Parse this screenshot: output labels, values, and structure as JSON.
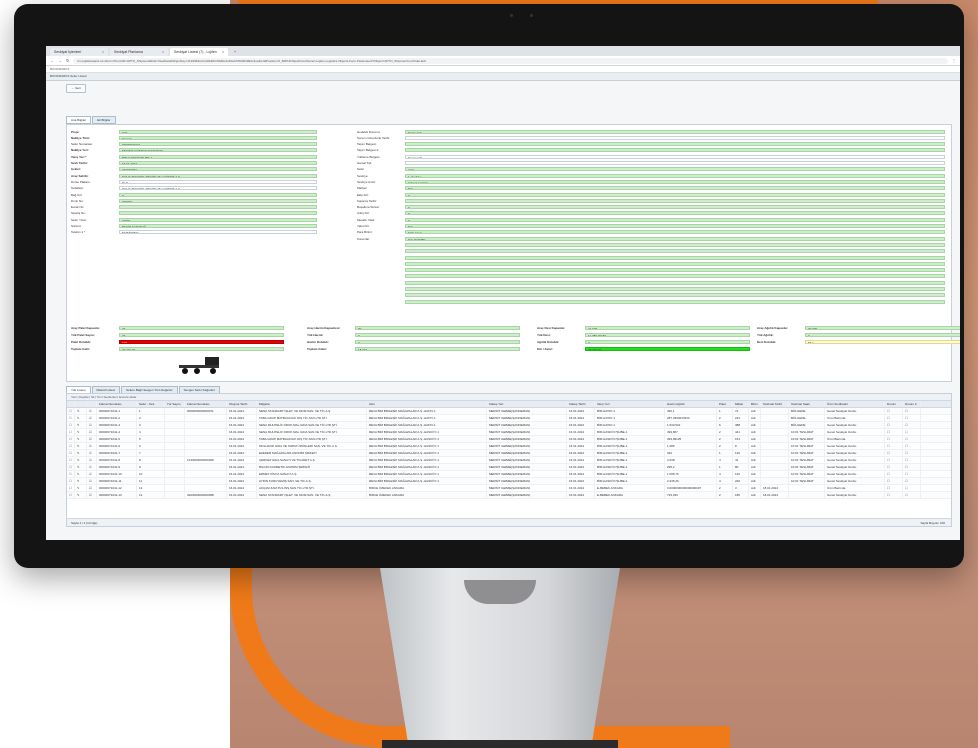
{
  "browser": {
    "tabs": [
      {
        "label": "Sevkiyat İşlemleri"
      },
      {
        "label": "Sevkiyat Planlama"
      },
      {
        "label": "Sevkiyat Listesi (7) - Lojiten"
      }
    ],
    "url": "bm.lojistiksiparis.com/Form?FormID=APTO_Shipment&Dat=ViewDetailObjectKey=113935&Col=dif1&ID=8&Mod=&Sid=P0000409Active&GridPosition=0_8087&ObjectFormName=Lojiten.Logistics.Objects.Form.Parameters?Object=APTO_ShipmentIn.txOrder.Exit",
    "bookmarks": "BOOKMARKS",
    "appbar": "BOOKMARKS  Sefer Listesi"
  },
  "toolbar": {
    "button": "← Geri"
  },
  "form_tabs": [
    {
      "label": "Ana Bilgiler"
    },
    {
      "label": "Ek Bilgiler"
    }
  ],
  "left_fields": [
    {
      "label": "Proje:",
      "value": "IHO",
      "bold": true,
      "style": "green"
    },
    {
      "label": "Nakliye Türü:",
      "value": "Komple",
      "bold": true,
      "style": "green"
    },
    {
      "label": "Sefer Numarası:",
      "value": "00000071041",
      "bold": false,
      "style": "green"
    },
    {
      "label": "Nakliye Yeri:",
      "value": "MERSİT GEBZE(ŞANDEMAN)",
      "bold": true,
      "style": "green"
    },
    {
      "label": "Varış Yeri *",
      "value": "BİM HASKÖY/ŞUBE-1",
      "bold": true,
      "style": "green"
    },
    {
      "label": "Sevk Tarihi:",
      "value": "16.01.2024",
      "bold": true,
      "style": "green"
    },
    {
      "label": "Çekici:",
      "value": "43ADD454",
      "bold": true,
      "style": "green"
    },
    {
      "label": "Araç Sahibi:",
      "value": "DOHA TEDARİK ZİNCİRİ VE LOJİSTİK A.Ş.",
      "bold": true,
      "style": "green"
    },
    {
      "label": "Dorse Plakası:",
      "value": "RLD",
      "bold": false,
      "style": "white"
    },
    {
      "label": "Tedarikçi:",
      "value": "DOHA TEDARİK ZİNCİRİ VE LOJİSTİK A.Ş.",
      "bold": false,
      "style": "white"
    },
    {
      "label": "Bağ Kiri:",
      "value": "0",
      "bold": false,
      "style": "green"
    },
    {
      "label": "Dorin No:",
      "value": "700000",
      "bold": false,
      "style": "green"
    },
    {
      "label": "Evrak No:",
      "value": "",
      "bold": false,
      "style": "green"
    },
    {
      "label": "Sipariş No:",
      "value": "",
      "bold": false,
      "style": "green"
    },
    {
      "label": "Sefer Yönü:",
      "value": "GİDİŞ",
      "bold": false,
      "style": "green"
    },
    {
      "label": "Sürücü:",
      "value": "BEKİR KARATUĞ",
      "bold": false,
      "style": "green"
    },
    {
      "label": "Telefon 1 *",
      "value": "5335459832",
      "bold": false,
      "style": "white"
    }
  ],
  "right_fields": [
    {
      "label": "Hedefeli Durumu:",
      "value": "Teslim Edi",
      "style": "green"
    },
    {
      "label": "Sonum Görevlerle Tarihi:",
      "value": "",
      "style": "white"
    },
    {
      "label": "Taşım Belgesi:",
      "value": "",
      "style": "green"
    },
    {
      "label": "Taşım Belgesi 2:",
      "value": "",
      "style": "green"
    },
    {
      "label": "Yükleme Belgesi:",
      "value": "Dosya.pdf",
      "style": "white"
    },
    {
      "label": "Hamal Tipi:",
      "value": "",
      "style": "white"
    },
    {
      "label": "Sefer",
      "value": "Adet",
      "style": "green"
    },
    {
      "label": "Sevkiye:",
      "value": "1. Sevkiye",
      "style": "green"
    },
    {
      "label": "Sevkiye Amiri:",
      "value": "Yılmaz sevkiler",
      "style": "green"
    },
    {
      "label": "Maliyet:",
      "value": "N/A",
      "style": "green"
    },
    {
      "label": "Ekip Kiri:",
      "value": "0",
      "style": "green"
    },
    {
      "label": "Kapanış Tarihi:",
      "value": "",
      "style": "green"
    },
    {
      "label": "Boşaltma Süresi:",
      "value": "0",
      "style": "green"
    },
    {
      "label": "Çıkış Kiri:",
      "value": "0",
      "style": "green"
    },
    {
      "label": "Mesafe Yakıt:",
      "value": "0",
      "style": "green"
    },
    {
      "label": "Yakıt Kiri:",
      "value": "N/A",
      "style": "green"
    },
    {
      "label": "Para Birimi:",
      "value": "Türk Lirası",
      "style": "green"
    },
    {
      "label": "Kurumlar:",
      "value": "DALIP TOBE",
      "style": "green"
    }
  ],
  "summary": {
    "row1": [
      {
        "label": "Araç Palet Kapasite:",
        "value": "33"
      },
      {
        "label": "Araç Hacim Kapasitesi:",
        "value": "90"
      },
      {
        "label": "Araç Desi Kapasite:",
        "value": "21.000"
      },
      {
        "label": "Araç Ağırlık Kapasite:",
        "value": "30.000"
      }
    ],
    "row2": [
      {
        "label": "Yük Palet Sayısı:",
        "value": "33"
      },
      {
        "label": "Yük Hacmi:",
        "value": "0"
      },
      {
        "label": "Yük Desi:",
        "value": "11.789,00184"
      },
      {
        "label": "Yük Ağırlık:",
        "value": "0"
      }
    ],
    "row3": [
      {
        "label": "Palet Doluluk:",
        "value": "100"
      },
      {
        "label": "Hacim Doluluk:",
        "value": "0"
      },
      {
        "label": "Ağırlık Doluluk:",
        "value": "0"
      },
      {
        "label": "Desi Doluluk:",
        "value": "56,1"
      }
    ],
    "row4": [
      {
        "label": "Toplam Gelir:",
        "value": "23.401,00"
      },
      {
        "label": "Toplam Gider:",
        "value": "18.019"
      },
      {
        "label": "Kâr / Zarar:",
        "value": "23.401,00"
      }
    ]
  },
  "grid_tabs": [
    {
      "label": "Yük Listesi"
    },
    {
      "label": "Masraf Listesi"
    },
    {
      "label": "Sefere Bağlı Sevgen Tüm Değerler"
    },
    {
      "label": "Sevgen Sefer Değerleri"
    }
  ],
  "grid": {
    "toolbar": "Yeni  |  Kaydet  |  Sil  |  Tüm Seçilenler  |  Excel'e Aktar",
    "columns": [
      "",
      "",
      "",
      "Fatura Numarası",
      "Sefer - Sıra",
      "Tür Sayısı",
      "Fatura Numarası",
      "Oluşma Tarihi",
      "Mağaza",
      "Alıcı",
      "Kabuş Yeri",
      "Kabuş Tarihi",
      "Varış Yeri",
      "Hacim Ağırlık",
      "Palet",
      "Miktar",
      "Birim",
      "Teslimat Tarihi",
      "Teslimat Saatı",
      "Ürün Sınıflandır",
      "Durum",
      "Durum 2"
    ],
    "rows": [
      [
        "☐",
        "✎",
        "☑",
        "00000071041-1",
        "1",
        "",
        "0000000000000071",
        "16.01.2024",
        "SENA STANDART İŞLET. VE MOM.SAN. VE TİC.A.Ş.",
        "REVA BİM BİRLEŞİK MAĞAZALAR A.Ş.-HATAY-1",
        "MERSİT GEBZE(ŞANDEMAN)",
        "16.01.2024",
        "BİM HATAY-1",
        "492,1",
        "1",
        "72",
        "Adt",
        "",
        "BÖLGEDE",
        "Genel Sevkiyat Grubu",
        "☐",
        "☐"
      ],
      [
        "☐",
        "✎",
        "☑",
        "00000071041-2",
        "2",
        "",
        "",
        "16.01.2024",
        "TABA GRUP MATBAACILIK DIŞ TİC.SAN.LTD.ŞTİ.",
        "REVA BİM BİRLEŞİK MAĞAZALAR A.Ş.-HATAY-1",
        "MERSİT GEBZE(ŞANDEMAN)",
        "16.01.2024",
        "BİM HATAY-1",
        "287,0394633333",
        "2",
        "243",
        "Adt",
        "",
        "BÖLGEDE",
        "Ürün Bazında",
        "☐",
        "☐"
      ],
      [
        "☐",
        "✎",
        "☑",
        "00000071041-3",
        "3",
        "",
        "",
        "16.01.2024",
        "SENA MUHTELİF DROK.MAL.GIDA SAN.VE TİC.LTD.ŞTİ.",
        "REVA BİM BİRLEŞİK MAĞAZALAR A.Ş.-HATAY-1",
        "MERSİT GEBZE(ŞANDEMAN)",
        "16.01.2024",
        "BİM HATAY-1",
        "1.530,522",
        "6",
        "388",
        "Adt",
        "",
        "BÖLGEDE",
        "Genel Sevkiyat Grubu",
        "☐",
        "☐"
      ],
      [
        "☐",
        "✎",
        "☑",
        "00000071041-4",
        "4",
        "",
        "",
        "16.01.2024",
        "SENA MUHTELİF DROK.MAL.GIDA SAN.VE TİC.LTD.ŞTİ.",
        "REVA BİM BİRLEŞİK MAĞAZALAR A.Ş.-HASKÖY-1",
        "MERSİT GEBZE(ŞANDEMAN)",
        "16.01.2024",
        "BİM HASKÖY/ŞUBE-1",
        "499,867",
        "2",
        "441",
        "Adt",
        "",
        "10:01 TESLİMAT",
        "Genel Sevkiyat Grubu",
        "☐",
        "☐"
      ],
      [
        "☐",
        "✎",
        "☑",
        "00000071041-5",
        "5",
        "",
        "",
        "16.01.2024",
        "TABA GRUP MATBAACILIK DIŞ TİC.SAN.LTD.ŞTİ.",
        "REVA BİM BİRLEŞİK MAĞAZALAR A.Ş.-HASKÖY-1",
        "MERSİT GEBZE(ŞANDEMAN)",
        "16.01.2024",
        "BİM HASKÖY/ŞUBE-1",
        "393,99125",
        "2",
        "151",
        "Adt",
        "",
        "10:01 TESLİMAT",
        "Ürün Bazında",
        "☐",
        "☐"
      ],
      [
        "☐",
        "✎",
        "☑",
        "00000071041-6",
        "6",
        "",
        "",
        "16.01.2024",
        "MOLHAND GIDA VE TARIM ÜRÜNLERİ SAN. VE TİC.A.Ş.",
        "REVA BİM BİRLEŞİK MAĞAZALAR A.Ş.-HASKÖY-1",
        "MERSİT GEBZE(ŞANDEMAN)",
        "16.01.2024",
        "BİM HASKÖY/ŞUBE-1",
        "1.285",
        "2",
        "8",
        "Adt",
        "",
        "10:01 TESLİMAT",
        "Genel Sevkiyat Grubu",
        "☐",
        "☐"
      ],
      [
        "☐",
        "✎",
        "☑",
        "00000071041-7",
        "7",
        "",
        "",
        "16.01.2024",
        "EZEFEM MAĞAZALARI ANONİM ŞİRKETİ",
        "REVA BİM BİRLEŞİK MAĞAZALAR A.Ş.-HASKÖY-1",
        "MERSİT GEBZE(ŞANDEMAN)",
        "16.01.2024",
        "BİM HASKÖY/ŞUBE-1",
        "332",
        "1",
        "120",
        "Adt",
        "",
        "10:01 TESLİMAT",
        "Genel Sevkiyat Grubu",
        "☐",
        "☐"
      ],
      [
        "☐",
        "✎",
        "☑",
        "00000071041-8",
        "8",
        "",
        "1233000000000028",
        "16.01.2024",
        "ÇERKEZ GIDA SANAYİ VE TİCARET A.Ş.",
        "REVA BİM BİRLEŞİK MAĞAZALAR A.Ş.-HASKÖY-1",
        "MERSİT GEBZE(ŞANDEMAN)",
        "16.01.2024",
        "BİM HASKÖY/ŞUBE-1",
        "2.038",
        "4",
        "41",
        "Adt",
        "",
        "10:01 TESLİMAT",
        "Genel Sevkiyat Grubu",
        "☐",
        "☐"
      ],
      [
        "☐",
        "✎",
        "☑",
        "00000071041-9",
        "9",
        "",
        "",
        "16.01.2024",
        "BİLGİN KOZMETİK ANONİM ŞİRKETİ",
        "REVA BİM BİRLEŞİK MAĞAZALAR A.Ş.-HASKÖY-1",
        "MERSİT GEBZE(ŞANDEMAN)",
        "16.01.2024",
        "BİM HASKÖY/ŞUBE-1",
        "295,2",
        "1",
        "80",
        "Adt",
        "",
        "10:01 TESLİMAT",
        "Genel Sevkiyat Grubu",
        "☐",
        "☐"
      ],
      [
        "☐",
        "✎",
        "☑",
        "00000071041-10",
        "10",
        "",
        "",
        "16.01.2024",
        "ERMET KİMYA SANAYİ A.Ş.",
        "REVA BİM BİRLEŞİK MAĞAZALAR A.Ş.-HASKÖY-1",
        "MERSİT GEBZE(ŞANDEMAN)",
        "16.01.2024",
        "BİM HASKÖY/ŞUBE-1",
        "1.098,76",
        "4",
        "120",
        "Adt",
        "",
        "10:01 TESLİMAT",
        "Genel Sevkiyat Grubu",
        "☐",
        "☐"
      ],
      [
        "☐",
        "✎",
        "☑",
        "00000071041-11",
        "11",
        "",
        "",
        "16.01.2024",
        "AYDIN KURUYEMİŞ SAN. VE TİC.A.Ş.",
        "REVA BİM BİRLEŞİK MAĞAZALAR A.Ş.-HASKÖY-1",
        "MERSİT GEBZE(ŞANDEMAN)",
        "16.01.2024",
        "BİM HASKÖY/ŞUBE-1",
        "2.345,26",
        "4",
        "240",
        "Adt",
        "",
        "10:01 TESLİMAT",
        "Genel Sevkiyat Grubu",
        "☐",
        "☐"
      ],
      [
        "☐",
        "✎",
        "☑",
        "00000071041-12",
        "12",
        "",
        "",
        "16.01.2024",
        "AKÇAM ZAM PLS.İNŞ.SAN.TİC.LTD.ŞTİ.",
        "BİRCE ÖZEKEK ANKARA",
        "MERSİT GEBZE(ŞANDEMAN)",
        "16.01.2024",
        "E-BEBEK ANKARA",
        "0,0000000000000000007",
        "2",
        "3",
        "Adt",
        "18.01.2024",
        "",
        "Ürün Bazında",
        "☐",
        "☐"
      ],
      [
        "☐",
        "✎",
        "☑",
        "00000071041-13",
        "13",
        "",
        "3203000000000098",
        "16.01.2024",
        "SENA STANDART İŞLET. VE MOM.SAN. VE TİC.A.Ş.",
        "BİRCE ÖZEKEK ANKARA",
        "MERSİT GEBZE(ŞANDEMAN)",
        "16.01.2024",
        "E-BEBEK ANKARA",
        "733,333",
        "2",
        "180",
        "Adt",
        "18.01.2024",
        "",
        "Genel Sevkiyat Grubu",
        "☐",
        "☐"
      ]
    ],
    "footer_left": "Sayfa 1 / 1 (13 öğe)",
    "footer_right": "Sayfa Boyutu: 100"
  }
}
